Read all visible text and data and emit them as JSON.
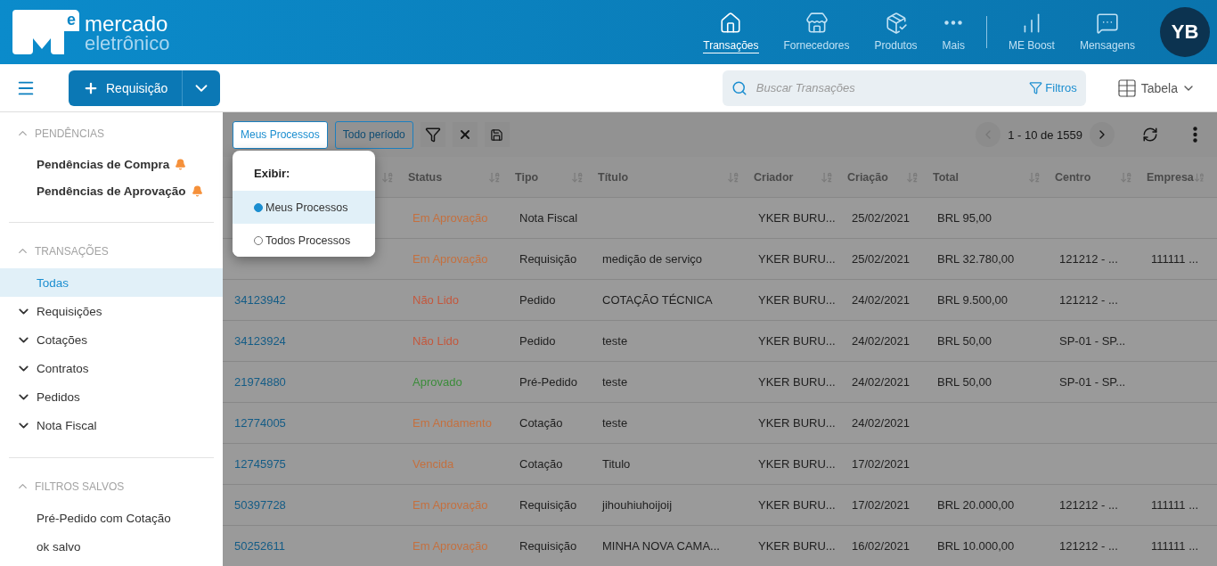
{
  "logo": {
    "mark": "e",
    "name": "mercado",
    "tagline": "eletrônico"
  },
  "nav": [
    {
      "label": "Transações",
      "selected": true
    },
    {
      "label": "Fornecedores",
      "selected": false
    },
    {
      "label": "Produtos",
      "selected": false
    },
    {
      "label": "Mais",
      "selected": false
    },
    {
      "label": "ME Boost",
      "selected": false
    },
    {
      "label": "Mensagens",
      "selected": false
    }
  ],
  "avatar": "YB",
  "new_button": "Requisição",
  "search": {
    "placeholder": "Buscar Transações",
    "filters": "Filtros"
  },
  "view_select": "Tabela",
  "sidebar": [
    {
      "title": "PENDÊNCIAS",
      "expanded": true,
      "items": [
        {
          "label": "Pendências de Compra",
          "kind": "alert",
          "selected": false
        },
        {
          "label": "Pendências de Aprovação",
          "kind": "alert",
          "selected": false
        }
      ]
    },
    {
      "title": "TRANSAÇÕES",
      "expanded": true,
      "items": [
        {
          "label": "Todas",
          "kind": "link",
          "selected": true
        },
        {
          "label": "Requisições",
          "kind": "group",
          "expanded": false,
          "selected": false
        },
        {
          "label": "Cotações",
          "kind": "group",
          "expanded": false,
          "selected": false
        },
        {
          "label": "Contratos",
          "kind": "group",
          "expanded": false,
          "selected": false
        },
        {
          "label": "Pedidos",
          "kind": "group",
          "expanded": false,
          "selected": false
        },
        {
          "label": "Nota Fiscal",
          "kind": "group",
          "expanded": false,
          "selected": false
        }
      ]
    },
    {
      "title": "FILTROS SALVOS",
      "expanded": true,
      "items": [
        {
          "label": "Pré-Pedido com Cotação",
          "kind": "saved",
          "selected": false
        },
        {
          "label": "ok salvo",
          "kind": "saved",
          "selected": false
        }
      ]
    }
  ],
  "toolbar": {
    "scope": "Meus Processos",
    "period": "Todo período",
    "pagination": "1 - 10 de 1559"
  },
  "popup": {
    "title": "Exibir:",
    "options": [
      {
        "label": "Meus Processos",
        "selected": true
      },
      {
        "label": "Todos Processos",
        "selected": false
      }
    ]
  },
  "columns": [
    {},
    {
      "label": "Status"
    },
    {
      "label": "Tipo"
    },
    {
      "label": "Título"
    },
    {
      "label": "Criador"
    },
    {
      "label": "Criação"
    },
    {
      "label": "Total"
    },
    {
      "label": "Centro"
    },
    {
      "label": "Empresa"
    }
  ],
  "rows": [
    {
      "status": "Em Aprovação",
      "color": "#c4703f",
      "type": "Nota Fiscal",
      "creator": "YKER BURU...",
      "created": "25/02/2021",
      "total": "BRL 95,00"
    },
    {
      "status": "Em Aprovação",
      "color": "#c4703f",
      "type": "Requisição",
      "title": "medição de serviço",
      "creator": "YKER BURU...",
      "created": "25/02/2021",
      "total": "BRL 32.780,00",
      "center": "121212 - ...",
      "company": "111111 ..."
    },
    {
      "id": "34123942",
      "status": "Não Lido",
      "color": "#c4573c",
      "type": "Pedido",
      "title": "COTAÇÃO TÉCNICA",
      "creator": "YKER BURU...",
      "created": "24/02/2021",
      "total": "BRL 9.500,00",
      "center": "121212 - ..."
    },
    {
      "id": "34123924",
      "status": "Não Lido",
      "color": "#c4573c",
      "type": "Pedido",
      "title": "teste",
      "creator": "YKER BURU...",
      "created": "24/02/2021",
      "total": "BRL 50,00",
      "center": "SP-01 - SP..."
    },
    {
      "id": "21974880",
      "status": "Aprovado",
      "color": "#3b8c3a",
      "type": "Pré-Pedido",
      "title": "teste",
      "creator": "YKER BURU...",
      "created": "24/02/2021",
      "total": "BRL 50,00",
      "center": "SP-01 - SP..."
    },
    {
      "id": "12774005",
      "status": "Em Andamento",
      "color": "#c4703f",
      "type": "Cotação",
      "title": "teste",
      "creator": "YKER BURU...",
      "created": "24/02/2021"
    },
    {
      "id": "12745975",
      "status": "Vencida",
      "color": "#c4703f",
      "type": "Cotação",
      "title": "Titulo",
      "creator": "YKER BURU...",
      "created": "17/02/2021"
    },
    {
      "id": "50397728",
      "status": "Em Aprovação",
      "color": "#c4703f",
      "type": "Requisição",
      "title": "jihouhiuhoijoij",
      "creator": "YKER BURU...",
      "created": "17/02/2021",
      "total": "BRL 20.000,00",
      "center": "121212 - ...",
      "company": "111111 ..."
    },
    {
      "id": "50252611",
      "status": "Em Aprovação",
      "color": "#c4703f",
      "type": "Requisição",
      "title": "MINHA NOVA CAMA...",
      "creator": "YKER BURU...",
      "created": "16/02/2021",
      "total": "BRL 10.000,00",
      "center": "121212 - ...",
      "company": "111111 ..."
    }
  ]
}
